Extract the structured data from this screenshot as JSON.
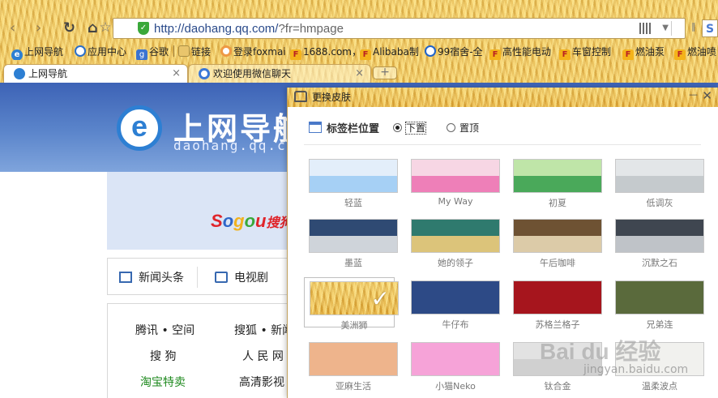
{
  "toolbar": {
    "back": "‹",
    "forward": "›",
    "reload": "↻",
    "home": "⌂",
    "star": "☆",
    "url_host": "http://daohang.qq.com/",
    "url_rest": "?fr=hmpage",
    "dropdown": "▼",
    "menu": "‖",
    "brand": "S"
  },
  "bookmarks": [
    {
      "label": "上网导航",
      "icon": "qq-browser-icon"
    },
    {
      "label": "应用中心",
      "icon": "app-center-icon"
    },
    {
      "label": "谷歌",
      "icon": "google-icon"
    },
    {
      "label": "链接",
      "icon": "folder-icon"
    },
    {
      "label": "登录foxmai",
      "icon": "foxmail-icon"
    },
    {
      "label": "1688.com，",
      "icon": "page-icon"
    },
    {
      "label": "Alibaba制",
      "icon": "page-icon"
    },
    {
      "label": "99宿舍-全",
      "icon": "site-icon"
    },
    {
      "label": "高性能电动",
      "icon": "page-icon"
    },
    {
      "label": "车窗控制",
      "icon": "page-icon"
    },
    {
      "label": "燃油泵",
      "icon": "page-icon"
    },
    {
      "label": "燃油喷",
      "icon": "page-icon"
    }
  ],
  "tabs": [
    {
      "label": "上网导航",
      "active": true
    },
    {
      "label": "欢迎使用微信聊天",
      "active": false
    }
  ],
  "new_tab": "+",
  "page": {
    "logo_letter": "e",
    "logo_title": "上网导航",
    "logo_sub": "daohang.qq.com",
    "sogou": [
      "S",
      "o",
      "g",
      "o",
      "u",
      "搜狗"
    ],
    "news": [
      {
        "label": "新闻头条",
        "icon": "news-icon"
      },
      {
        "label": "电视剧",
        "icon": "tv-icon"
      }
    ],
    "links": [
      {
        "label": "腾讯 • 空间",
        "green": false
      },
      {
        "label": "搜狐 • 新闻",
        "green": false
      },
      {
        "label": "搜 狗",
        "green": false
      },
      {
        "label": "人 民 网",
        "green": false
      },
      {
        "label": "淘宝特卖",
        "green": true
      },
      {
        "label": "高清影视",
        "green": false
      }
    ]
  },
  "skin_panel": {
    "title": "更换皮肤",
    "minimize": "—",
    "close": "✕",
    "position_label": "标签栏位置",
    "option_bottom": "下置",
    "option_top": "置顶",
    "selected_position": "下置",
    "selected_skin": "美洲狮",
    "skins": [
      {
        "name": "轻蓝",
        "top": "#e3eefa",
        "bottom": "#a6d0f5"
      },
      {
        "name": "My Way",
        "top": "#f7d6e4",
        "bottom": "#ee7fb8"
      },
      {
        "name": "初夏",
        "top": "#bfe5a8",
        "bottom": "#4aa95a"
      },
      {
        "name": "低调灰",
        "top": "#e3e6e8",
        "bottom": "#c5cacd"
      },
      {
        "name": "墨蓝",
        "top": "#2f4a73",
        "bottom": "#cfd4da"
      },
      {
        "name": "她的领子",
        "top": "#2f7a6e",
        "bottom": "#dcc47a"
      },
      {
        "name": "午后咖啡",
        "top": "#6e5233",
        "bottom": "#dccba8"
      },
      {
        "name": "沉默之石",
        "top": "#3f4650",
        "bottom": "#bfc3c8"
      },
      {
        "name": "美洲狮",
        "top": "#e8b64b",
        "bottom": "#e8b64b"
      },
      {
        "name": "牛仔布",
        "top": "#2d4a86",
        "bottom": "#2d4a86"
      },
      {
        "name": "苏格兰格子",
        "top": "#a6151d",
        "bottom": "#a6151d"
      },
      {
        "name": "兄弟连",
        "top": "#5a6a3c",
        "bottom": "#5a6a3c"
      },
      {
        "name": "亚麻生活",
        "top": "#eeb48c",
        "bottom": "#eeb48c"
      },
      {
        "name": "小猫Neko",
        "top": "#f6a3d8",
        "bottom": "#f6a3d8"
      },
      {
        "name": "钛合金",
        "top": "#e2e2e2",
        "bottom": "#d0d0d0"
      },
      {
        "name": "温柔波点",
        "top": "#f1f1ee",
        "bottom": "#f1f1ee"
      }
    ]
  },
  "watermark": {
    "text": "Bai du 经验",
    "sub": "jingyan.baidu.com"
  }
}
